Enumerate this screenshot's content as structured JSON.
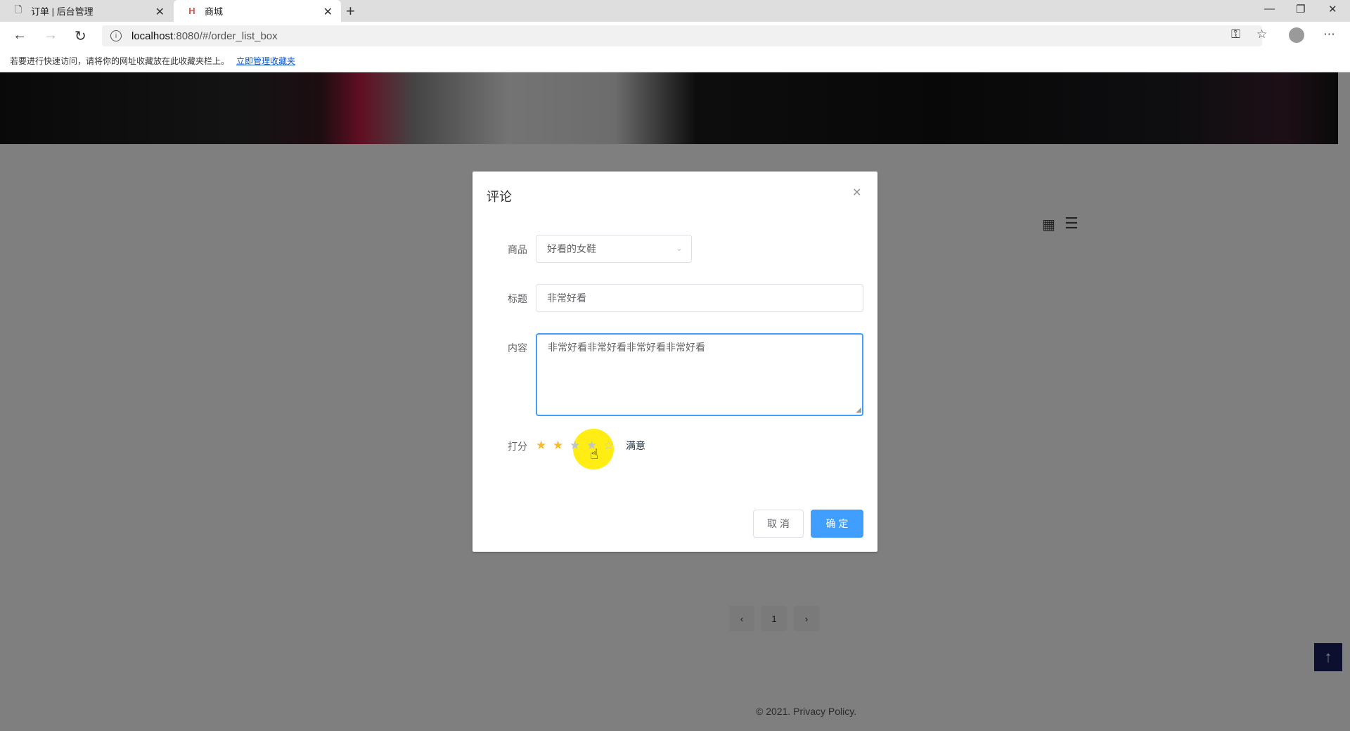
{
  "browser": {
    "tabs": [
      {
        "title": "订单 | 后台管理"
      },
      {
        "title": "商城"
      }
    ],
    "url_host": "localhost",
    "url_path": ":8080/#/order_list_box",
    "favbar_text": "若要进行快速访问，请将你的网址收藏放在此收藏夹栏上。",
    "favbar_link": "立即管理收藏夹"
  },
  "page": {
    "pagination_current": "1",
    "footer": "© 2021.  Privacy Policy."
  },
  "dialog": {
    "title": "评论",
    "product_label": "商品",
    "product_value": "好看的女鞋",
    "title_label": "标题",
    "title_value": "非常好看",
    "content_label": "内容",
    "content_value": "非常好看非常好看非常好看非常好看",
    "rating_label": "打分",
    "rating_value": 2,
    "rating_max": 5,
    "rating_text": "满意",
    "cancel_label": "取 消",
    "confirm_label": "确 定"
  },
  "colors": {
    "primary": "#409eff",
    "star_on": "#f7ba2a",
    "backtop": "#1a1f5e",
    "cursor_highlight": "#ffeb00"
  }
}
